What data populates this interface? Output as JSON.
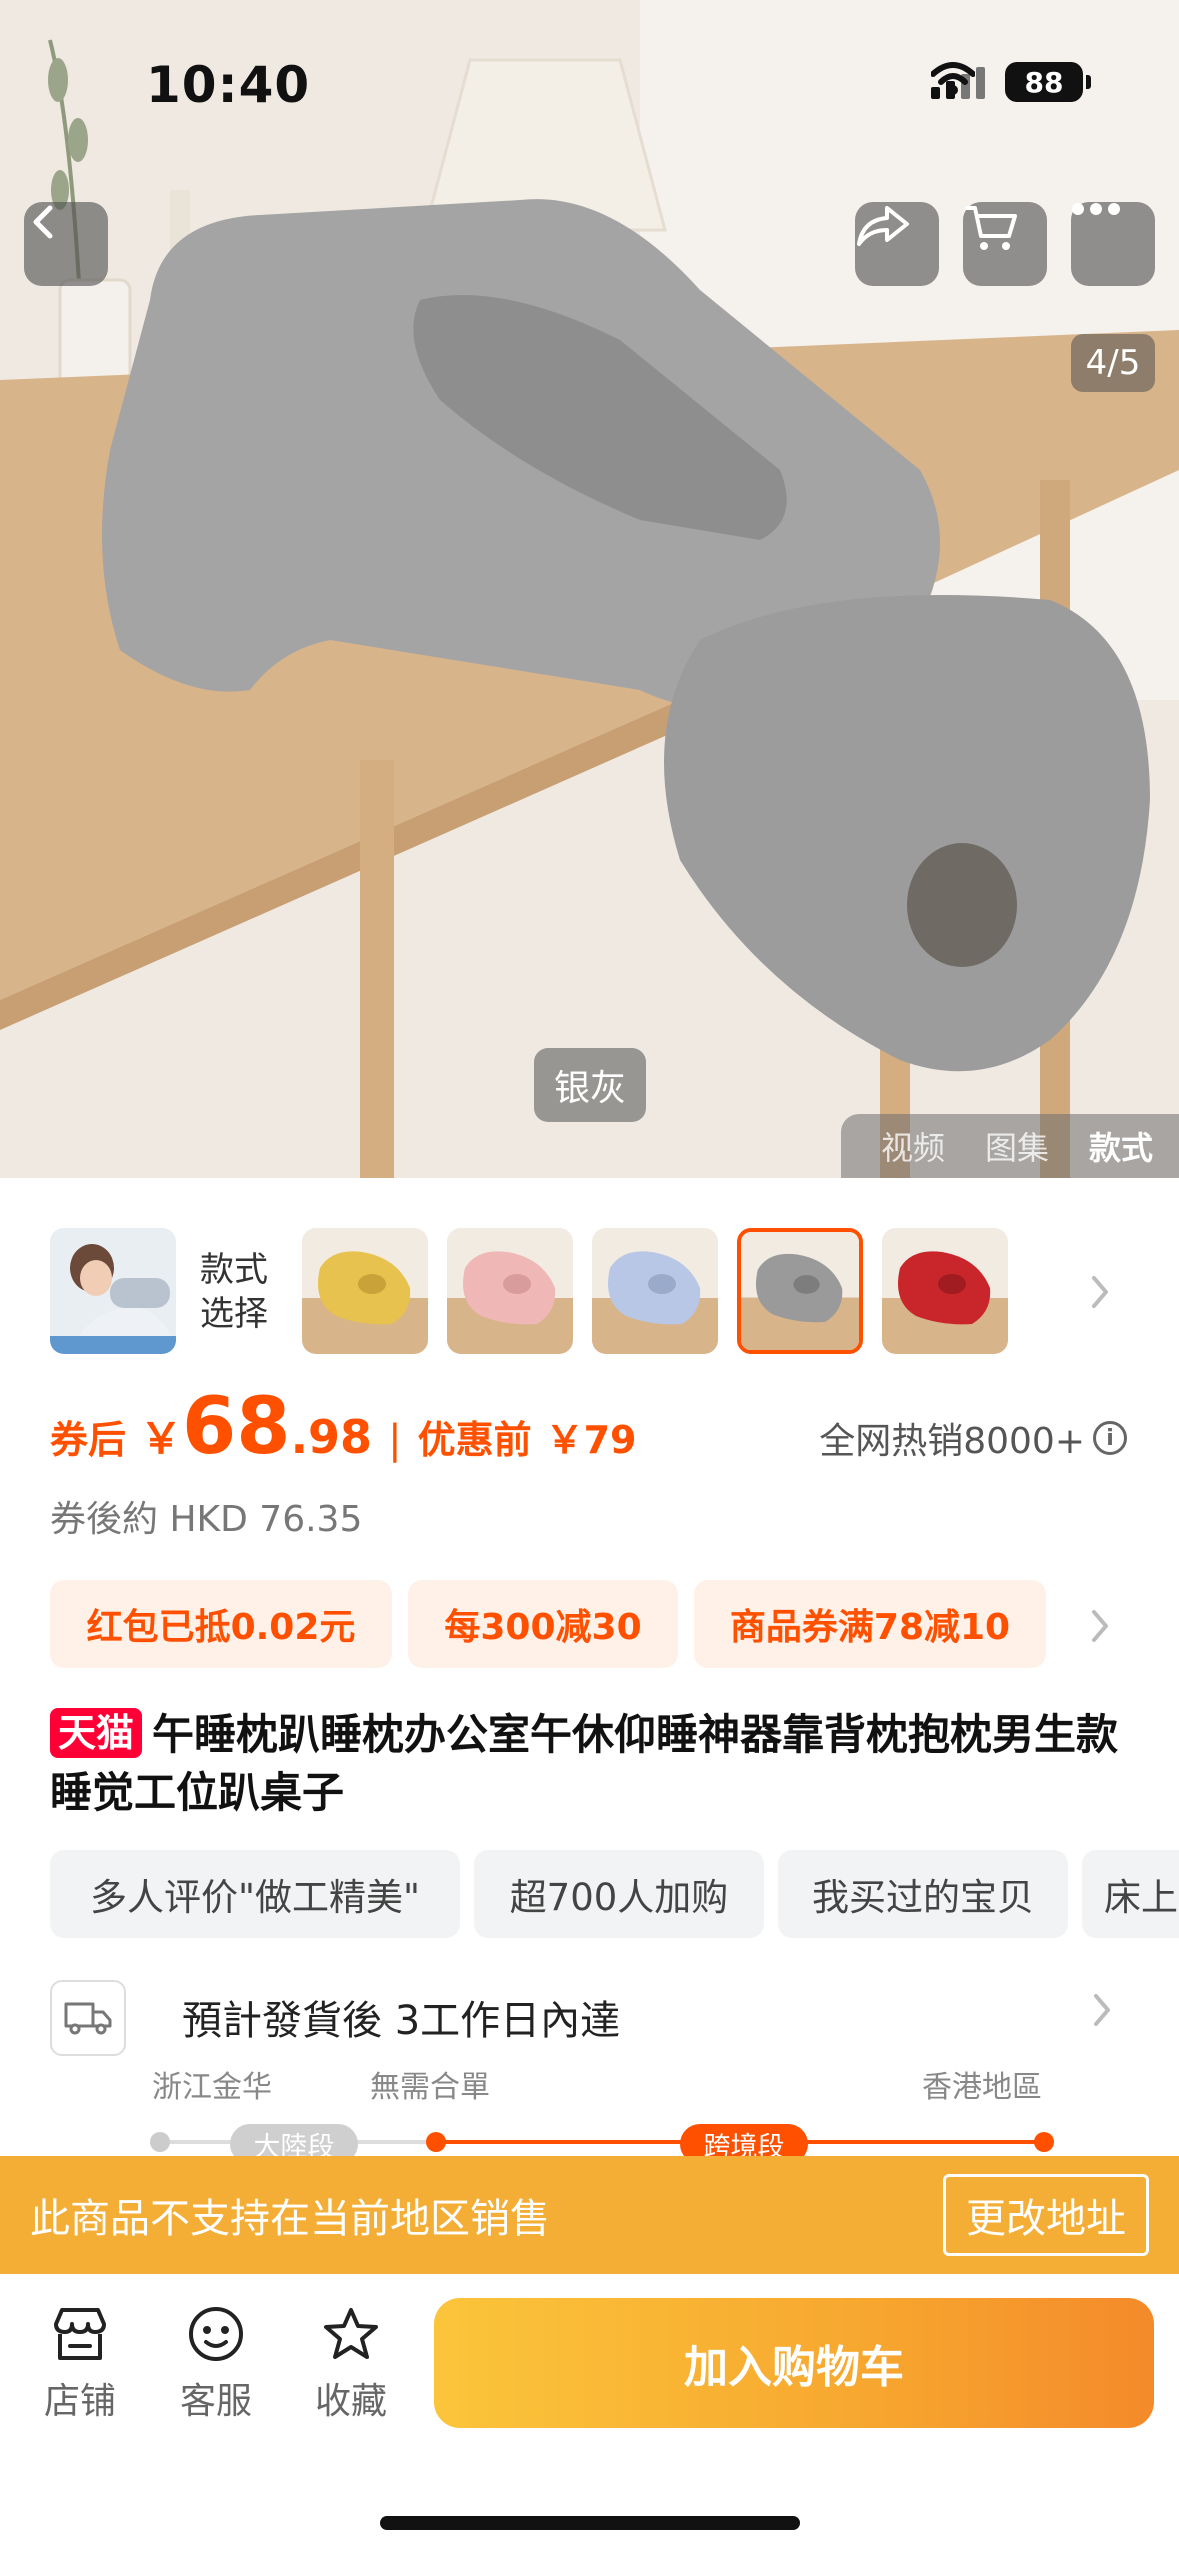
{
  "status_bar": {
    "time": "10:40",
    "battery": "88"
  },
  "hero": {
    "pager": "4/5",
    "variant_caption": "银灰",
    "media_tabs": [
      {
        "label": "视频",
        "active": false
      },
      {
        "label": "图集",
        "active": false
      },
      {
        "label": "款式",
        "active": true
      }
    ]
  },
  "variants": {
    "label_line1": "款式",
    "label_line2": "选择",
    "colors": [
      "#e7c24e",
      "#f0b7b7",
      "#b9c7e6",
      "#9a9a9a",
      "#c8262b"
    ],
    "selected_index": 3
  },
  "price": {
    "after_coupon_label": "券后",
    "currency": "￥",
    "integer": "68",
    "decimal": ".98",
    "separator": "|",
    "before_label": "优惠前",
    "before_price": "￥79",
    "hot_sales": "全网热销8000+",
    "hkd": "券後約 HKD 76.35"
  },
  "coupons": [
    "红包已抵0.02元",
    "每300减30",
    "商品券满78减10"
  ],
  "title": {
    "badge": "天猫",
    "text": "午睡枕趴睡枕办公室午休仰睡神器靠背枕抱枕男生款睡觉工位趴桌子"
  },
  "tags": [
    "多人评价\"做工精美\"",
    "超700人加购",
    "我买过的宝贝",
    "床上"
  ],
  "shipping": {
    "text": "預計發貨後 3工作日內達",
    "from": "浙江金华",
    "middle": "無需合單",
    "to": "香港地區",
    "segment1": "大陸段",
    "segment2": "跨境段"
  },
  "banner": {
    "text": "此商品不支持在当前地区销售",
    "button": "更改地址"
  },
  "bottom_bar": {
    "store": "店铺",
    "service": "客服",
    "favorite": "收藏",
    "add_to_cart": "加入购物车"
  },
  "colors": {
    "accent": "#ff5000",
    "banner": "#f4ad35",
    "tmall": "#ff0036"
  }
}
